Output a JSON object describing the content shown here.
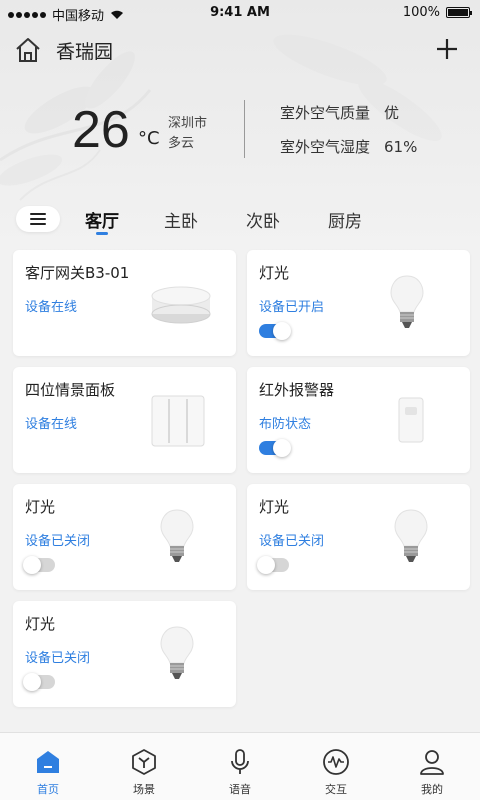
{
  "status_bar": {
    "carrier": "中国移动",
    "time": "9:41 AM",
    "battery": "100%"
  },
  "header": {
    "title": "香瑞园"
  },
  "weather": {
    "temperature": "26",
    "unit": "°C",
    "city": "深圳市",
    "condition": "多云",
    "air_quality_label": "室外空气质量",
    "air_quality_value": "优",
    "humidity_label": "室外空气湿度",
    "humidity_value": "61%"
  },
  "tabs": [
    {
      "label": "客厅",
      "active": true
    },
    {
      "label": "主卧",
      "active": false
    },
    {
      "label": "次卧",
      "active": false
    },
    {
      "label": "厨房",
      "active": false
    }
  ],
  "devices": [
    {
      "title": "客厅网关B3-01",
      "status": "设备在线",
      "icon": "gateway-icon"
    },
    {
      "title": "灯光",
      "status": "设备已开启",
      "icon": "bulb-icon",
      "toggle_on": true
    },
    {
      "title": "四位情景面板",
      "status": "设备在线",
      "icon": "switch-panel-icon"
    },
    {
      "title": "红外报警器",
      "status": "布防状态",
      "icon": "ir-sensor-icon",
      "toggle_on": true
    },
    {
      "title": "灯光",
      "status": "设备已关闭",
      "icon": "bulb-icon",
      "toggle_on": false
    },
    {
      "title": "灯光",
      "status": "设备已关闭",
      "icon": "bulb-icon",
      "toggle_on": false
    },
    {
      "title": "灯光",
      "status": "设备已关闭",
      "icon": "bulb-icon",
      "toggle_on": false
    }
  ],
  "bottom_nav": [
    {
      "label": "首页",
      "icon": "home-icon",
      "active": true
    },
    {
      "label": "场景",
      "icon": "scene-icon",
      "active": false
    },
    {
      "label": "语音",
      "icon": "microphone-icon",
      "active": false
    },
    {
      "label": "交互",
      "icon": "interaction-icon",
      "active": false
    },
    {
      "label": "我的",
      "icon": "user-icon",
      "active": false
    }
  ],
  "colors": {
    "accent": "#2f7fe0",
    "background": "#f2f2f2",
    "card": "#ffffff"
  }
}
